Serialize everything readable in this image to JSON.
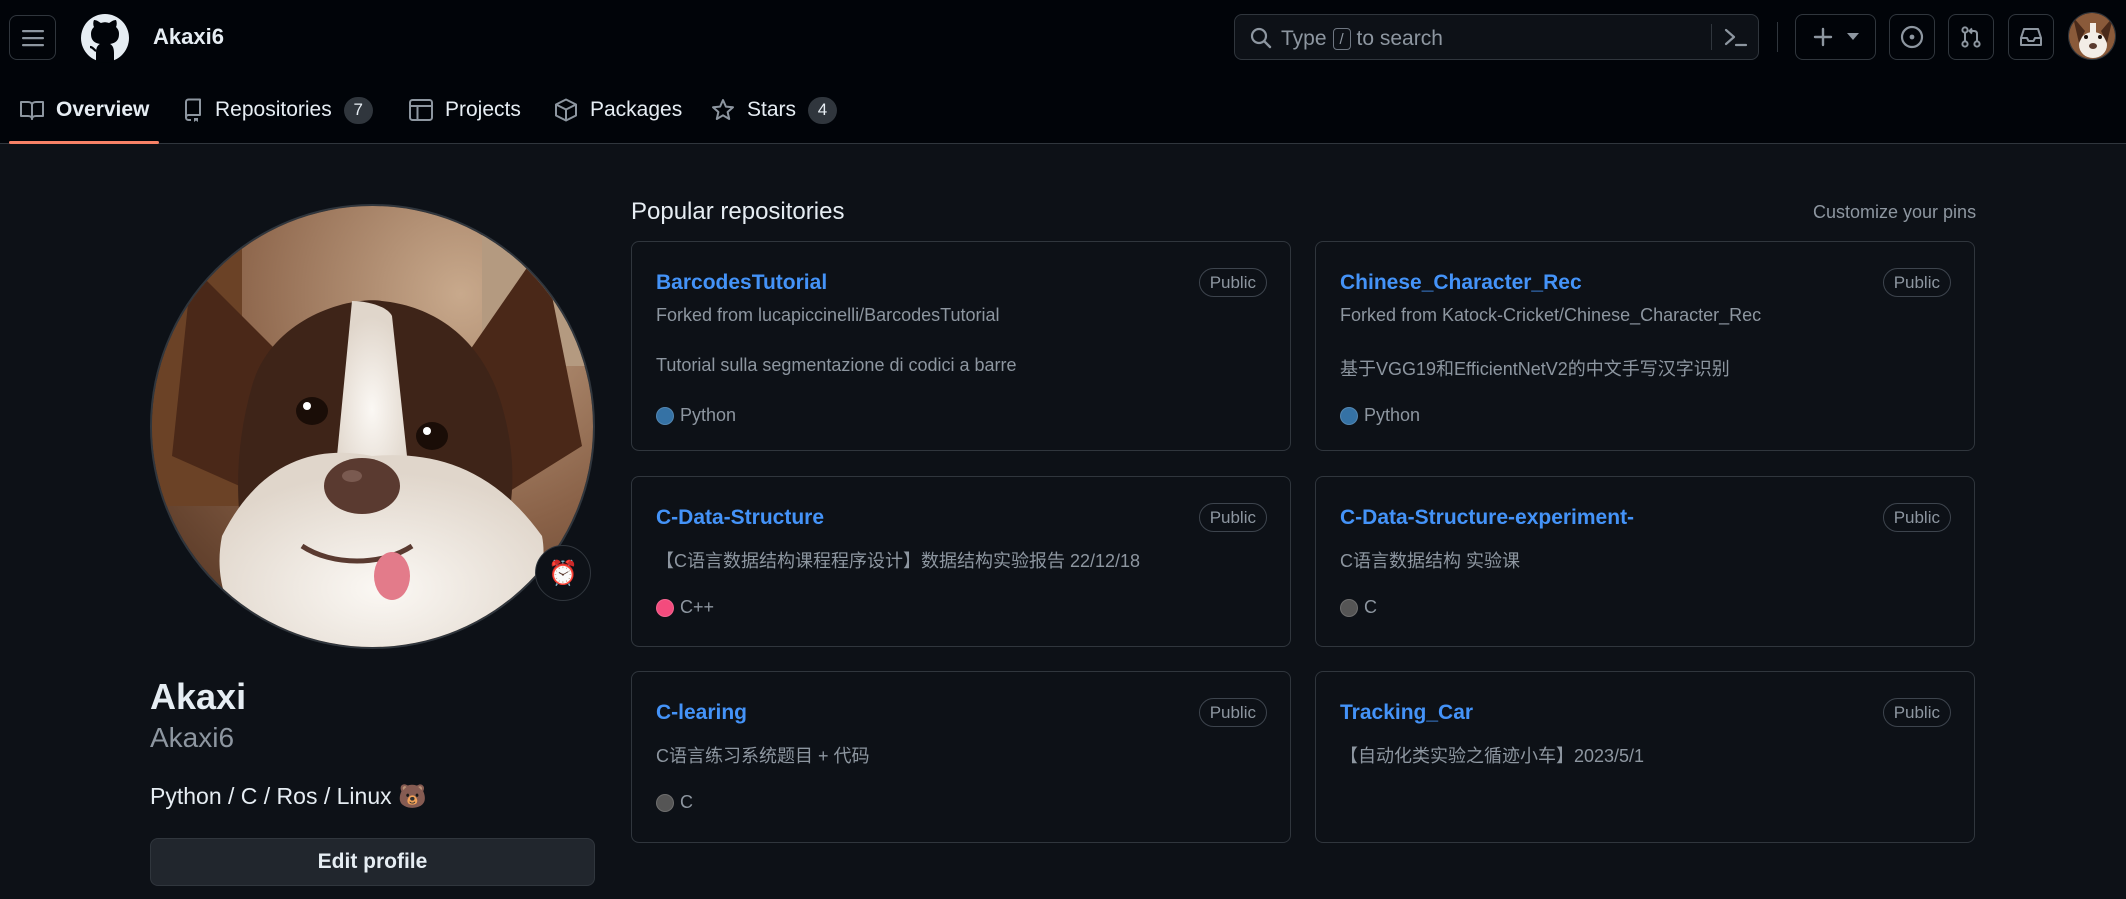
{
  "header": {
    "username": "Akaxi6",
    "search": {
      "prefix": "Type",
      "key": "/",
      "suffix": "to search"
    }
  },
  "tabs": [
    {
      "label": "Overview"
    },
    {
      "label": "Repositories",
      "count": "7"
    },
    {
      "label": "Projects"
    },
    {
      "label": "Packages"
    },
    {
      "label": "Stars",
      "count": "4"
    }
  ],
  "profile": {
    "name": "Akaxi",
    "login": "Akaxi6",
    "bio": "Python / C / Ros / Linux 🐻",
    "status_emoji": "⏰",
    "edit_label": "Edit profile"
  },
  "popular": {
    "title": "Popular repositories",
    "customize": "Customize your pins",
    "repos": [
      {
        "name": "BarcodesTutorial",
        "visibility": "Public",
        "fork": "Forked from lucapiccinelli/BarcodesTutorial",
        "description": "Tutorial sulla segmentazione di codici a barre",
        "language": "Python",
        "lang_color": "#3572A5"
      },
      {
        "name": "Chinese_Character_Rec",
        "visibility": "Public",
        "fork": "Forked from Katock-Cricket/Chinese_Character_Rec",
        "description": "基于VGG19和EfficientNetV2的中文手写汉字识别",
        "language": "Python",
        "lang_color": "#3572A5"
      },
      {
        "name": "C-Data-Structure",
        "visibility": "Public",
        "description": "【C语言数据结构课程程序设计】数据结构实验报告 22/12/18",
        "language": "C++",
        "lang_color": "#f34b7d"
      },
      {
        "name": "C-Data-Structure-experiment-",
        "visibility": "Public",
        "description": "C语言数据结构 实验课",
        "language": "C",
        "lang_color": "#555555"
      },
      {
        "name": "C-learing",
        "visibility": "Public",
        "description": "C语言练习系统题目 + 代码",
        "language": "C",
        "lang_color": "#555555"
      },
      {
        "name": "Tracking_Car",
        "visibility": "Public",
        "description": "【自动化类实验之循迹小车】2023/5/1"
      }
    ]
  },
  "colors": {
    "accent": "#4493f8",
    "tab_underline": "#f78166",
    "bg": "#0d1117",
    "header_bg": "#010409"
  }
}
